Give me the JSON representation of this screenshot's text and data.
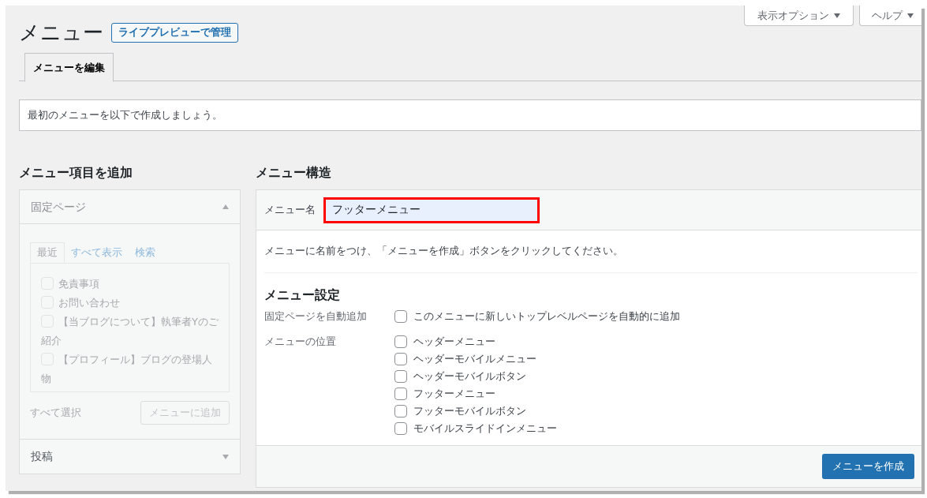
{
  "header": {
    "title": "メニュー",
    "live_preview_button": "ライブプレビューで管理",
    "screen_options_button": "表示オプション",
    "help_button": "ヘルプ"
  },
  "tabs": [
    {
      "label": "メニューを編集",
      "selected": true
    }
  ],
  "notice": "最初のメニューを以下で作成しましょう。",
  "add_items": {
    "heading": "メニュー項目を追加",
    "sections": [
      {
        "title": "固定ページ",
        "expanded": true,
        "disabled": true,
        "tabs": [
          {
            "label": "最近",
            "selected": true
          },
          {
            "label": "すべて表示",
            "selected": false
          },
          {
            "label": "検索",
            "selected": false
          }
        ],
        "items": [
          {
            "label": "免責事項",
            "checked": false
          },
          {
            "label": "お問い合わせ",
            "checked": false
          },
          {
            "label": "【当ブログについて】執筆者Yのご紹介",
            "checked": false
          },
          {
            "label": "【プロフィール】ブログの登場人物",
            "checked": false
          }
        ],
        "select_all": "すべて選択",
        "add_button": "メニューに追加"
      },
      {
        "title": "投稿",
        "expanded": false
      }
    ]
  },
  "structure": {
    "heading": "メニュー構造",
    "name_label": "メニュー名",
    "name_value": "フッターメニュー",
    "name_highlighted": true,
    "instruction": "メニューに名前をつけ、「メニューを作成」ボタンをクリックしてください。",
    "settings_heading": "メニュー設定",
    "auto_add": {
      "label": "固定ページを自動追加",
      "options": [
        {
          "label": "このメニューに新しいトップレベルページを自動的に追加",
          "checked": false
        }
      ]
    },
    "locations": {
      "label": "メニューの位置",
      "options": [
        {
          "label": "ヘッダーメニュー",
          "checked": false
        },
        {
          "label": "ヘッダーモバイルメニュー",
          "checked": false
        },
        {
          "label": "ヘッダーモバイルボタン",
          "checked": false
        },
        {
          "label": "フッターメニュー",
          "checked": false
        },
        {
          "label": "フッターモバイルボタン",
          "checked": false
        },
        {
          "label": "モバイルスライドインメニュー",
          "checked": false
        }
      ]
    },
    "create_button": "メニューを作成"
  }
}
